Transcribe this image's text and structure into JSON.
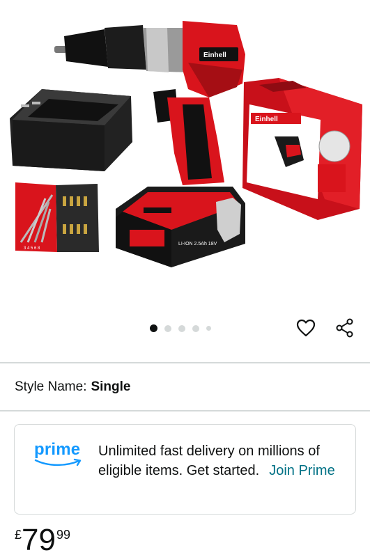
{
  "gallery": {
    "total_images": 5,
    "active_index": 0,
    "product_brand_text": "Einhell",
    "battery_label": "LI-ION 2.5Ah 18V",
    "bit_case_numbers": "3 4 5 6 8"
  },
  "actions": {
    "wishlist_icon": "heart-outline-icon",
    "share_icon": "share-icon"
  },
  "style": {
    "label": "Style Name:",
    "value": "Single"
  },
  "prime": {
    "logo_text": "prime",
    "message": "Unlimited fast delivery on millions of eligible items. Get started.",
    "link": "Join Prime"
  },
  "price": {
    "symbol": "£",
    "whole": "79",
    "fraction": "99"
  },
  "colors": {
    "brand_red": "#d9141c",
    "prime_blue": "#1399ff",
    "link_teal": "#007185",
    "divider": "#d5d9d9"
  }
}
